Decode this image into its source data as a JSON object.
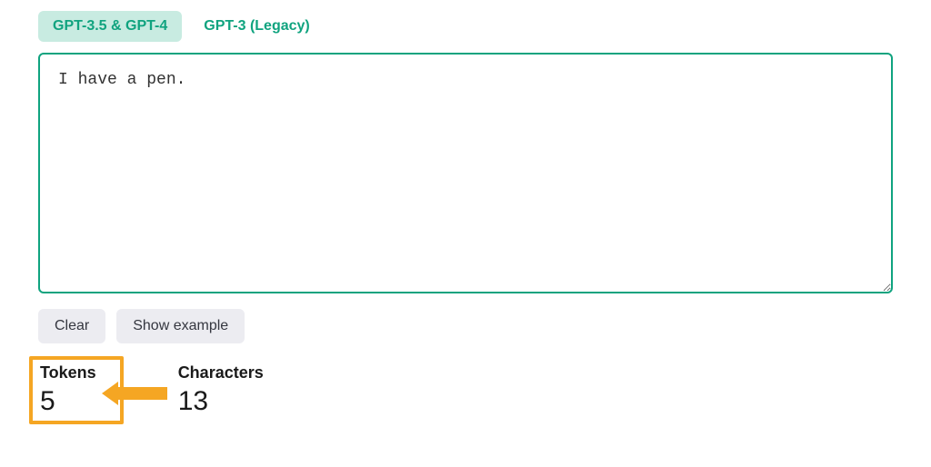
{
  "tabs": {
    "active": "GPT-3.5 & GPT-4",
    "inactive": "GPT-3 (Legacy)"
  },
  "textarea": {
    "value": "I have a pen."
  },
  "buttons": {
    "clear": "Clear",
    "show_example": "Show example"
  },
  "stats": {
    "tokens_label": "Tokens",
    "tokens_value": "5",
    "characters_label": "Characters",
    "characters_value": "13"
  },
  "colors": {
    "accent": "#10a37f",
    "highlight": "#f5a623"
  }
}
